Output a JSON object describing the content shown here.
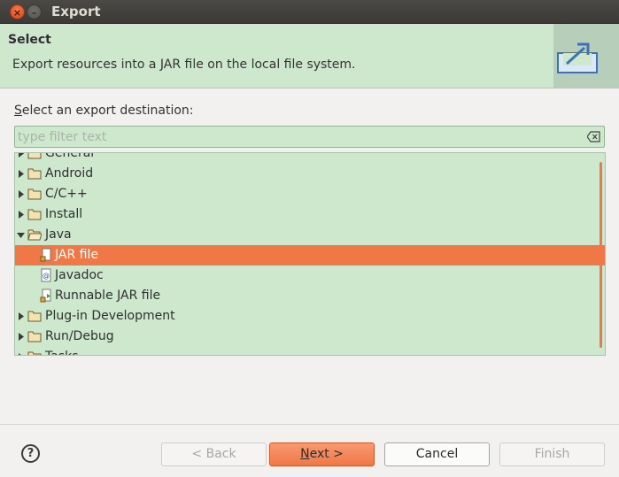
{
  "window": {
    "title": "Export"
  },
  "header": {
    "title": "Select",
    "description": "Export resources into a JAR file on the local file system."
  },
  "destination": {
    "label_underlined": "S",
    "label_rest": "elect an export destination:"
  },
  "filter": {
    "placeholder": "type filter text",
    "value": ""
  },
  "tree": {
    "items": [
      {
        "label": "General",
        "kind": "folder",
        "expanded": false,
        "level": 0
      },
      {
        "label": "Android",
        "kind": "folder",
        "expanded": false,
        "level": 0
      },
      {
        "label": "C/C++",
        "kind": "folder",
        "expanded": false,
        "level": 0
      },
      {
        "label": "Install",
        "kind": "folder",
        "expanded": false,
        "level": 0
      },
      {
        "label": "Java",
        "kind": "folder",
        "expanded": true,
        "level": 0
      },
      {
        "label": "JAR file",
        "kind": "jar-icon",
        "selected": true,
        "level": 1
      },
      {
        "label": "Javadoc",
        "kind": "javadoc-icon",
        "level": 1
      },
      {
        "label": "Runnable JAR file",
        "kind": "runnable-jar-icon",
        "level": 1
      },
      {
        "label": "Plug-in Development",
        "kind": "folder",
        "expanded": false,
        "level": 0
      },
      {
        "label": "Run/Debug",
        "kind": "folder",
        "expanded": false,
        "level": 0
      },
      {
        "label": "Tasks",
        "kind": "folder",
        "expanded": false,
        "level": 0
      }
    ]
  },
  "buttons": {
    "help": "?",
    "back": "< Back",
    "next_underlined": "N",
    "next_rest": "ext >",
    "cancel": "Cancel",
    "finish": "Finish"
  },
  "colors": {
    "accent": "#f07746",
    "panel": "#cde8cd",
    "titlebar": "#3b3a37"
  }
}
